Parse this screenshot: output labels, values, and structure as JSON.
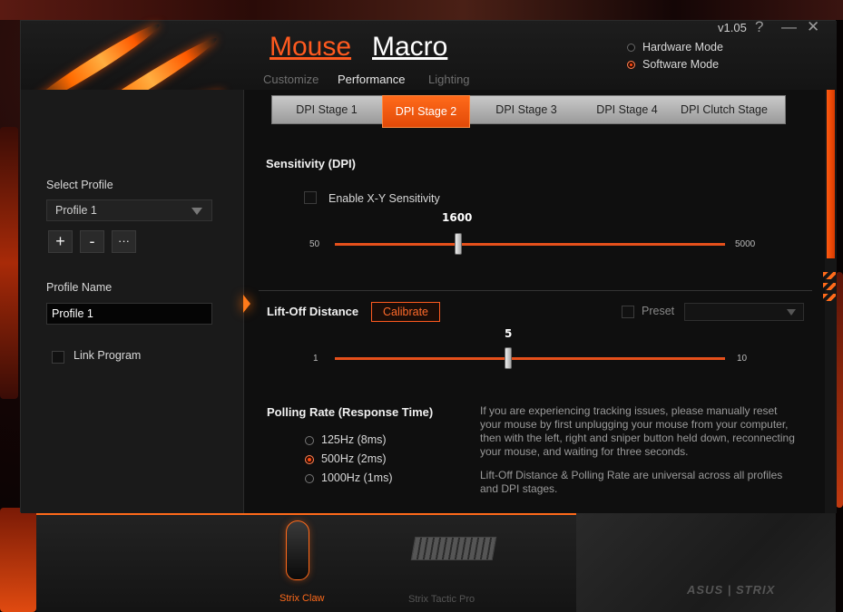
{
  "app": {
    "version": "v1.05"
  },
  "window_controls": {
    "help": "?",
    "minimize": "—",
    "close": "✕"
  },
  "nav": {
    "main": [
      {
        "label": "Mouse",
        "active": true
      },
      {
        "label": "Macro",
        "active": false
      }
    ],
    "subtabs": [
      {
        "label": "Customize"
      },
      {
        "label": "Performance",
        "active": true
      },
      {
        "label": "Lighting"
      }
    ]
  },
  "modes": [
    {
      "label": "Hardware Mode",
      "selected": false
    },
    {
      "label": "Software Mode",
      "selected": true
    }
  ],
  "sidebar": {
    "select_profile_label": "Select Profile",
    "profile_selected": "Profile 1",
    "buttons": {
      "add": "+",
      "remove": "-",
      "more": "···"
    },
    "profile_name_label": "Profile Name",
    "profile_name_value": "Profile 1",
    "link_program_label": "Link Program"
  },
  "dpi_stages": [
    {
      "label": "DPI Stage 1"
    },
    {
      "label": "DPI Stage 2",
      "active": true
    },
    {
      "label": "DPI Stage 3"
    },
    {
      "label": "DPI Stage 4"
    },
    {
      "label": "DPI Clutch Stage"
    }
  ],
  "sensitivity": {
    "title": "Sensitivity (DPI)",
    "xy_label": "Enable X-Y Sensitivity",
    "min": "50",
    "max": "5000",
    "value": "1600"
  },
  "liftoff": {
    "title": "Lift-Off Distance",
    "calibrate": "Calibrate",
    "preset_label": "Preset",
    "min": "1",
    "max": "10",
    "value": "5"
  },
  "polling": {
    "title": "Polling Rate (Response Time)",
    "options": [
      {
        "label": "125Hz (8ms)",
        "selected": false
      },
      {
        "label": "500Hz (2ms)",
        "selected": true
      },
      {
        "label": "1000Hz (1ms)",
        "selected": false
      }
    ]
  },
  "info": {
    "p1": "If you are experiencing tracking issues, please manually reset your mouse by first unplugging your mouse from your computer, then with the left, right and sniper button held down, reconnecting your mouse, and waiting for three seconds.",
    "p2": "Lift-Off Distance & Polling Rate are universal across all profiles and DPI stages."
  },
  "devices": [
    {
      "name": "Strix Claw",
      "active": true
    },
    {
      "name": "Strix Tactic Pro",
      "active": false
    }
  ],
  "branding": {
    "logo": "ASUS | STRIX"
  },
  "colors": {
    "accent": "#ff5a1f",
    "active_tab": "#e24a08",
    "slider_track": "#e5501b"
  }
}
